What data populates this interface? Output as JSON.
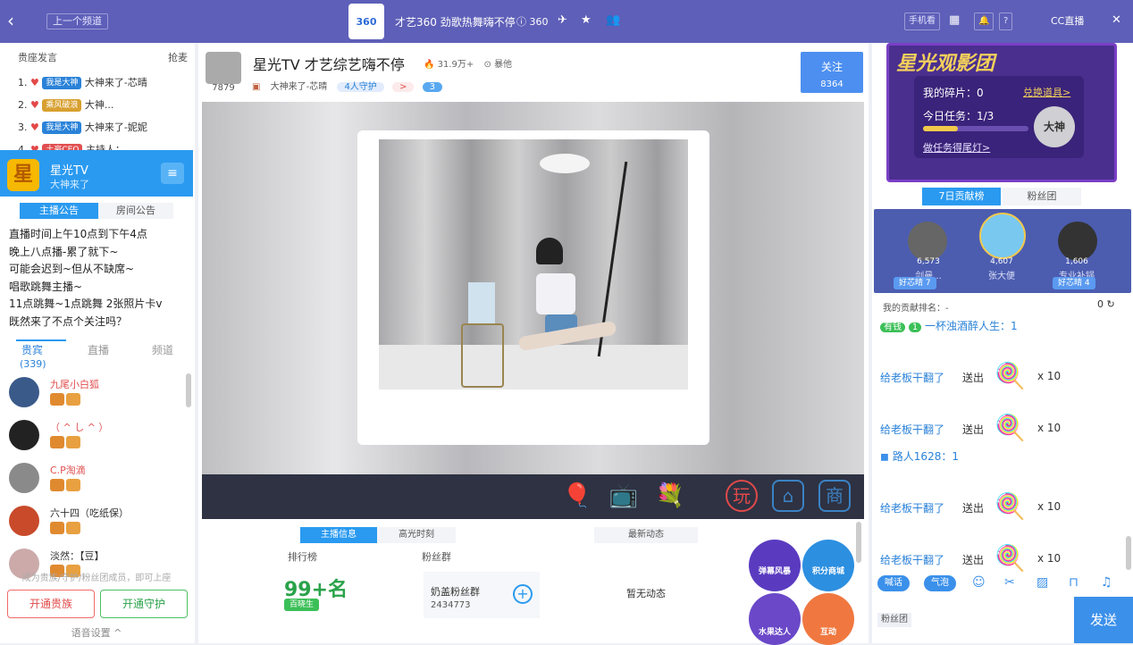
{
  "topbar": {
    "back_icon": "chevron-left-icon",
    "prev_channel": "上一个频道",
    "logo_text": "360",
    "title": "才艺360 劲歌热舞嗨不停",
    "channel_id": "360",
    "phone_label": "手机看",
    "cc_label": "CC直播"
  },
  "left": {
    "rank_title": "贵座发言",
    "rank_action": "抢麦",
    "ranks": [
      {
        "no": "1.",
        "badge": "我是大神",
        "name": "大神来了-芯晴"
      },
      {
        "no": "2.",
        "badge": "乘风破浪",
        "name": "大神..."
      },
      {
        "no": "3.",
        "badge": "我是大神",
        "name": "大神来了-妮妮"
      },
      {
        "no": "4.",
        "badge": "土豪CEO",
        "name": "主持人：..."
      }
    ],
    "anchor": {
      "avatar": "星",
      "name": "星光TV",
      "sub": "大神来了"
    },
    "notice_tabs": [
      "主播公告",
      "房间公告"
    ],
    "notice_lines": [
      "直播时间上午10点到下午4点",
      "晚上八点播-累了就下~",
      "可能会迟到~但从不缺席~",
      "唱歌跳舞主播~",
      "11点跳舞~1点跳舞   2张照片卡v",
      "既然来了不点个关注吗？"
    ],
    "viewer_tabs": [
      "贵宾",
      "直播",
      "频道"
    ],
    "viewer_count": "(339)",
    "users": [
      {
        "name": "九尾小白狐",
        "color": "#e05050"
      },
      {
        "name": "（ ^ し ^ ）",
        "color": "#e05050"
      },
      {
        "name": "C.P淘滴",
        "color": "#e05050"
      },
      {
        "name": "六十四（吃纸保）",
        "color": "#333333"
      },
      {
        "name": "淡然：【豆】",
        "color": "#333333"
      }
    ],
    "footer_tip": "成为贵族/守护/粉丝团成员，即可上座",
    "btn_noble": "开通贵族",
    "btn_guard": "开通守护",
    "voice": "语音设置 ^"
  },
  "room": {
    "id": "7879",
    "title": "星光TV 才艺综艺嗨不停",
    "heat": "31.9万+",
    "record": "暴他",
    "follow_label": "关注",
    "follow_count": "8364",
    "host": "大神来了-芯晴",
    "guard": "4人守护",
    "level": ">",
    "fans": "3"
  },
  "tabs_info": [
    "主播信息",
    "高光时刻"
  ],
  "info": {
    "rank_label": "排行榜",
    "fans_label": "粉丝群",
    "rank_value": "99+名",
    "rank_tag": "百晓生",
    "fan_group": "奶盖粉丝群",
    "fan_group_id": "2434773"
  },
  "news": {
    "tab": "最新动态",
    "empty": "暂无动态"
  },
  "plates": [
    "弹幕风暴",
    "积分商城",
    "水果达人",
    "互动"
  ],
  "right": {
    "banner_title": "星光观影团",
    "shard_label": "我的碎片：0",
    "exchange": "兑换道具>",
    "task": "今日任务：1/3",
    "task_link": "做任务得尾灯>",
    "badge_char": "大神",
    "rank_tabs": [
      "7日贡献榜",
      "粉丝团"
    ],
    "top3": [
      {
        "name": "剑曼...",
        "value": "6,573"
      },
      {
        "name": "张大便",
        "value": "4,607"
      },
      {
        "name": "专业补锅",
        "value": "1,606"
      }
    ],
    "left_tag": "好芯晴 7",
    "right_tag": "好芯晴 4",
    "my_rank": "我的贡献排名：-",
    "my_rank_val": "0",
    "chat": [
      {
        "type": "user",
        "tag": "有钱",
        "lv": "1",
        "text": "一杯浊酒醉人生：1"
      },
      {
        "type": "gift",
        "from": "给老板干翻了",
        "action": "送出",
        "count": "x 10"
      },
      {
        "type": "gift",
        "from": "给老板干翻了",
        "action": "送出",
        "count": "x 10"
      },
      {
        "type": "user",
        "tag": "",
        "lv": "",
        "text": "路人1628：1"
      },
      {
        "type": "gift",
        "from": "给老板干翻了",
        "action": "送出",
        "count": "x 10"
      },
      {
        "type": "gift",
        "from": "给老板干翻了",
        "action": "送出",
        "count": "x 10"
      }
    ],
    "tool_tabs": [
      "喊话",
      "气泡"
    ],
    "fan_tag": "粉丝团",
    "send": "发送"
  }
}
